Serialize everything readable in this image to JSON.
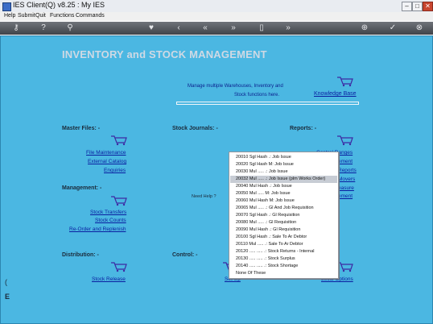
{
  "window": {
    "title": "IES Client(Q) v8.25 : My IES"
  },
  "menubar": [
    "Help",
    "Submit",
    "Quit",
    "Functions",
    "Commands"
  ],
  "toolbar": {
    "icons": [
      "key-icon",
      "help-icon",
      "search-icon",
      "heart-icon",
      "back-icon",
      "rewind-icon",
      "forward-icon",
      "doc-icon",
      "fast-forward-icon",
      "plus-icon",
      "check-icon",
      "close-icon"
    ]
  },
  "page": {
    "title": "INVENTORY and STOCK MANAGEMENT",
    "intro_line1": "Manage multiple Warehouses, Inventory and",
    "intro_line2": "Stock functions here.",
    "knowledge_base": "Knowledge Base",
    "need_help": "Need Help ?",
    "left_marker_top": "(",
    "left_marker": "E"
  },
  "sections": {
    "master_files": {
      "title": "Master Files: -",
      "links": [
        "File Maintenance",
        "External Catalog",
        "Enquiries"
      ]
    },
    "stock_journals": {
      "title": "Stock Journals: -"
    },
    "reports": {
      "title": "Reports: -",
      "links": [
        "Control Ranges",
        "ement",
        "Reports",
        "Movers",
        "easure",
        "ement"
      ]
    },
    "management": {
      "title": "Management: -",
      "links": [
        "Stock Transfers",
        "Stock Counts",
        "Re-Order and Replenish"
      ]
    },
    "distribution": {
      "title": "Distribution: -",
      "links": [
        "Stock Release"
      ]
    },
    "control": {
      "title": "Control: -",
      "links": [
        "Set Up"
      ]
    },
    "local": {
      "links": [
        "Local Options"
      ]
    }
  },
  "context_menu": {
    "selected_index": 3,
    "items": [
      "20010 Sgl Hash .: Job Issue",
      "20020 Sgl Hash M: Job Issue",
      "20030 Mul ..... .: Job Issue",
      "20032 Mul ..... .: Job Issue (plm Works Order)",
      "20040 Mul Hash .: Job Issue",
      "20050 Mul ..... M: Job Issue",
      "20060 Mul Hash M: Job Issue",
      "20065 Mul ..... .: Gl And Job Requisition",
      "20070 Sgl Hash .: Gl Requisition",
      "20080 Mul ..... .: Gl Requisition",
      "20090 Mul Hash .: Gl Requisition",
      "20100 Sgl Hash .: Sale To Ar Debtor",
      "20110 Mul ..... .: Sale To Ar Debtor",
      "20120 ..... ..... .: Stock Returns - Internal",
      "20130 ..... ..... .: Stock Surplus",
      "20140 ..... ..... .: Stock Shortage",
      "None Of These"
    ]
  }
}
